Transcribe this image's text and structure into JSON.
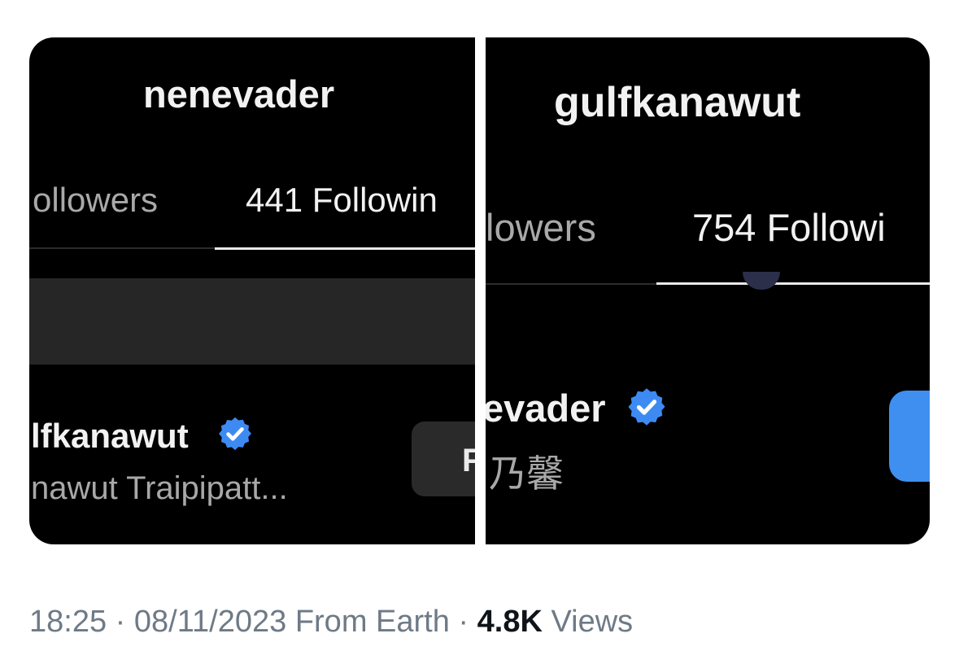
{
  "left_panel": {
    "username": "nenevader",
    "tab_followers": "ollowers",
    "tab_following": "441 Followin",
    "account_name": "lfkanawut",
    "account_fullname": "nawut Traipipatt...",
    "button_partial": "F"
  },
  "right_panel": {
    "username": "gulfkanawut",
    "tab_followers": "lowers",
    "tab_following": "754 Followi",
    "account_name": "evader",
    "account_fullname": "乃馨"
  },
  "tweet_meta": {
    "time": "18:25",
    "date": "08/11/2023",
    "source": "From Earth",
    "separator": "·",
    "views_count": "4.8K",
    "views_label": "Views"
  },
  "colors": {
    "verified_blue": "#3d8bf2",
    "follow_button_blue": "#3f8ff0",
    "panel_background": "#000000",
    "meta_gray": "#6e7a86"
  },
  "icons": [
    "verified-badge-icon"
  ]
}
